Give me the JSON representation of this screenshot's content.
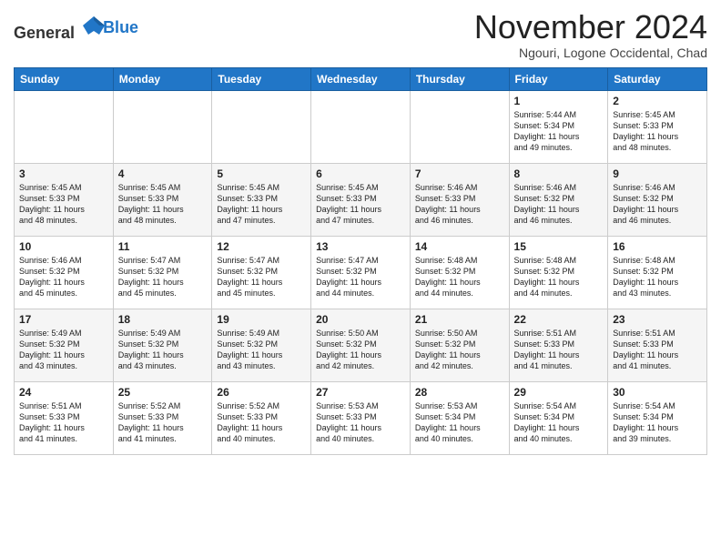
{
  "logo": {
    "general": "General",
    "blue": "Blue"
  },
  "header": {
    "month": "November 2024",
    "location": "Ngouri, Logone Occidental, Chad"
  },
  "weekdays": [
    "Sunday",
    "Monday",
    "Tuesday",
    "Wednesday",
    "Thursday",
    "Friday",
    "Saturday"
  ],
  "weeks": [
    [
      {
        "day": "",
        "info": ""
      },
      {
        "day": "",
        "info": ""
      },
      {
        "day": "",
        "info": ""
      },
      {
        "day": "",
        "info": ""
      },
      {
        "day": "",
        "info": ""
      },
      {
        "day": "1",
        "info": "Sunrise: 5:44 AM\nSunset: 5:34 PM\nDaylight: 11 hours\nand 49 minutes."
      },
      {
        "day": "2",
        "info": "Sunrise: 5:45 AM\nSunset: 5:33 PM\nDaylight: 11 hours\nand 48 minutes."
      }
    ],
    [
      {
        "day": "3",
        "info": "Sunrise: 5:45 AM\nSunset: 5:33 PM\nDaylight: 11 hours\nand 48 minutes."
      },
      {
        "day": "4",
        "info": "Sunrise: 5:45 AM\nSunset: 5:33 PM\nDaylight: 11 hours\nand 48 minutes."
      },
      {
        "day": "5",
        "info": "Sunrise: 5:45 AM\nSunset: 5:33 PM\nDaylight: 11 hours\nand 47 minutes."
      },
      {
        "day": "6",
        "info": "Sunrise: 5:45 AM\nSunset: 5:33 PM\nDaylight: 11 hours\nand 47 minutes."
      },
      {
        "day": "7",
        "info": "Sunrise: 5:46 AM\nSunset: 5:33 PM\nDaylight: 11 hours\nand 46 minutes."
      },
      {
        "day": "8",
        "info": "Sunrise: 5:46 AM\nSunset: 5:32 PM\nDaylight: 11 hours\nand 46 minutes."
      },
      {
        "day": "9",
        "info": "Sunrise: 5:46 AM\nSunset: 5:32 PM\nDaylight: 11 hours\nand 46 minutes."
      }
    ],
    [
      {
        "day": "10",
        "info": "Sunrise: 5:46 AM\nSunset: 5:32 PM\nDaylight: 11 hours\nand 45 minutes."
      },
      {
        "day": "11",
        "info": "Sunrise: 5:47 AM\nSunset: 5:32 PM\nDaylight: 11 hours\nand 45 minutes."
      },
      {
        "day": "12",
        "info": "Sunrise: 5:47 AM\nSunset: 5:32 PM\nDaylight: 11 hours\nand 45 minutes."
      },
      {
        "day": "13",
        "info": "Sunrise: 5:47 AM\nSunset: 5:32 PM\nDaylight: 11 hours\nand 44 minutes."
      },
      {
        "day": "14",
        "info": "Sunrise: 5:48 AM\nSunset: 5:32 PM\nDaylight: 11 hours\nand 44 minutes."
      },
      {
        "day": "15",
        "info": "Sunrise: 5:48 AM\nSunset: 5:32 PM\nDaylight: 11 hours\nand 44 minutes."
      },
      {
        "day": "16",
        "info": "Sunrise: 5:48 AM\nSunset: 5:32 PM\nDaylight: 11 hours\nand 43 minutes."
      }
    ],
    [
      {
        "day": "17",
        "info": "Sunrise: 5:49 AM\nSunset: 5:32 PM\nDaylight: 11 hours\nand 43 minutes."
      },
      {
        "day": "18",
        "info": "Sunrise: 5:49 AM\nSunset: 5:32 PM\nDaylight: 11 hours\nand 43 minutes."
      },
      {
        "day": "19",
        "info": "Sunrise: 5:49 AM\nSunset: 5:32 PM\nDaylight: 11 hours\nand 43 minutes."
      },
      {
        "day": "20",
        "info": "Sunrise: 5:50 AM\nSunset: 5:32 PM\nDaylight: 11 hours\nand 42 minutes."
      },
      {
        "day": "21",
        "info": "Sunrise: 5:50 AM\nSunset: 5:32 PM\nDaylight: 11 hours\nand 42 minutes."
      },
      {
        "day": "22",
        "info": "Sunrise: 5:51 AM\nSunset: 5:33 PM\nDaylight: 11 hours\nand 41 minutes."
      },
      {
        "day": "23",
        "info": "Sunrise: 5:51 AM\nSunset: 5:33 PM\nDaylight: 11 hours\nand 41 minutes."
      }
    ],
    [
      {
        "day": "24",
        "info": "Sunrise: 5:51 AM\nSunset: 5:33 PM\nDaylight: 11 hours\nand 41 minutes."
      },
      {
        "day": "25",
        "info": "Sunrise: 5:52 AM\nSunset: 5:33 PM\nDaylight: 11 hours\nand 41 minutes."
      },
      {
        "day": "26",
        "info": "Sunrise: 5:52 AM\nSunset: 5:33 PM\nDaylight: 11 hours\nand 40 minutes."
      },
      {
        "day": "27",
        "info": "Sunrise: 5:53 AM\nSunset: 5:33 PM\nDaylight: 11 hours\nand 40 minutes."
      },
      {
        "day": "28",
        "info": "Sunrise: 5:53 AM\nSunset: 5:34 PM\nDaylight: 11 hours\nand 40 minutes."
      },
      {
        "day": "29",
        "info": "Sunrise: 5:54 AM\nSunset: 5:34 PM\nDaylight: 11 hours\nand 40 minutes."
      },
      {
        "day": "30",
        "info": "Sunrise: 5:54 AM\nSunset: 5:34 PM\nDaylight: 11 hours\nand 39 minutes."
      }
    ]
  ]
}
